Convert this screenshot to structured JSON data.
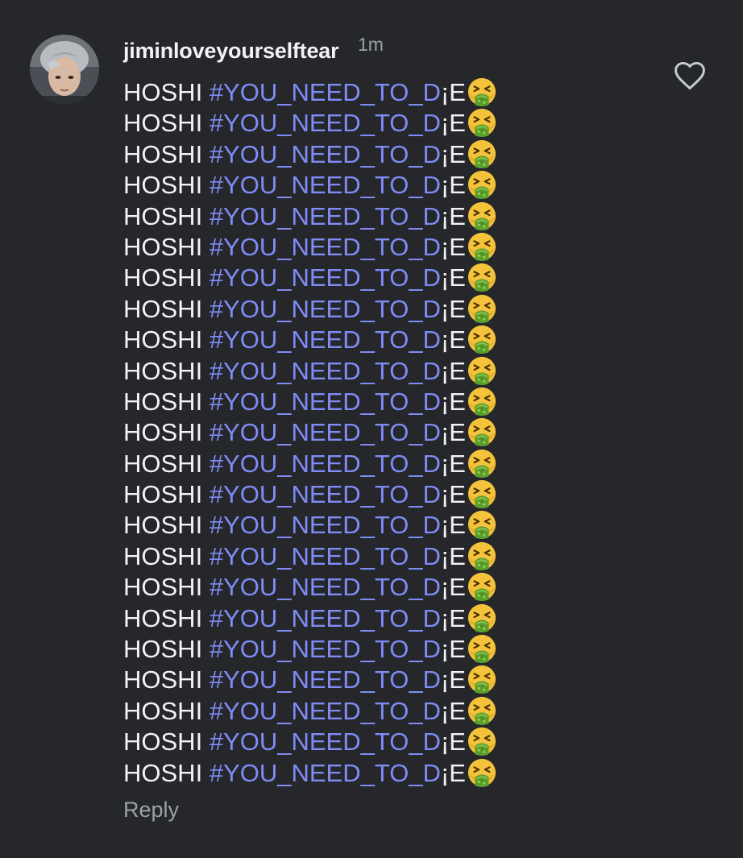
{
  "comment": {
    "username": "jiminloveyourselftear",
    "timestamp": "1m",
    "avatar_icon": "profile-photo",
    "like_icon": "heart-outline-icon",
    "reply_label": "Reply",
    "lines": [
      {
        "word": "HOSHI",
        "hashtag": "#YOU_NEED_TO_D",
        "tail": "¡E",
        "emoji": "nauseated-face-emoji"
      },
      {
        "word": "HOSHI",
        "hashtag": "#YOU_NEED_TO_D",
        "tail": "¡E",
        "emoji": "nauseated-face-emoji"
      },
      {
        "word": "HOSHI",
        "hashtag": "#YOU_NEED_TO_D",
        "tail": "¡E",
        "emoji": "nauseated-face-emoji"
      },
      {
        "word": "HOSHI",
        "hashtag": "#YOU_NEED_TO_D",
        "tail": "¡E",
        "emoji": "nauseated-face-emoji"
      },
      {
        "word": "HOSHI",
        "hashtag": "#YOU_NEED_TO_D",
        "tail": "¡E",
        "emoji": "nauseated-face-emoji"
      },
      {
        "word": "HOSHI",
        "hashtag": "#YOU_NEED_TO_D",
        "tail": "¡E",
        "emoji": "nauseated-face-emoji"
      },
      {
        "word": "HOSHI",
        "hashtag": "#YOU_NEED_TO_D",
        "tail": "¡E",
        "emoji": "nauseated-face-emoji"
      },
      {
        "word": "HOSHI",
        "hashtag": "#YOU_NEED_TO_D",
        "tail": "¡E",
        "emoji": "nauseated-face-emoji"
      },
      {
        "word": "HOSHI",
        "hashtag": "#YOU_NEED_TO_D",
        "tail": "¡E",
        "emoji": "nauseated-face-emoji"
      },
      {
        "word": "HOSHI",
        "hashtag": "#YOU_NEED_TO_D",
        "tail": "¡E",
        "emoji": "nauseated-face-emoji"
      },
      {
        "word": "HOSHI",
        "hashtag": "#YOU_NEED_TO_D",
        "tail": "¡E",
        "emoji": "nauseated-face-emoji"
      },
      {
        "word": "HOSHI",
        "hashtag": "#YOU_NEED_TO_D",
        "tail": "¡E",
        "emoji": "nauseated-face-emoji"
      },
      {
        "word": "HOSHI",
        "hashtag": "#YOU_NEED_TO_D",
        "tail": "¡E",
        "emoji": "nauseated-face-emoji"
      },
      {
        "word": "HOSHI",
        "hashtag": "#YOU_NEED_TO_D",
        "tail": "¡E",
        "emoji": "nauseated-face-emoji"
      },
      {
        "word": "HOSHI",
        "hashtag": "#YOU_NEED_TO_D",
        "tail": "¡E",
        "emoji": "nauseated-face-emoji"
      },
      {
        "word": "HOSHI",
        "hashtag": "#YOU_NEED_TO_D",
        "tail": "¡E",
        "emoji": "nauseated-face-emoji"
      },
      {
        "word": "HOSHI",
        "hashtag": "#YOU_NEED_TO_D",
        "tail": "¡E",
        "emoji": "nauseated-face-emoji"
      },
      {
        "word": "HOSHI",
        "hashtag": "#YOU_NEED_TO_D",
        "tail": "¡E",
        "emoji": "nauseated-face-emoji"
      },
      {
        "word": "HOSHI",
        "hashtag": "#YOU_NEED_TO_D",
        "tail": "¡E",
        "emoji": "nauseated-face-emoji"
      },
      {
        "word": "HOSHI",
        "hashtag": "#YOU_NEED_TO_D",
        "tail": "¡E",
        "emoji": "nauseated-face-emoji"
      },
      {
        "word": "HOSHI",
        "hashtag": "#YOU_NEED_TO_D",
        "tail": "¡E",
        "emoji": "nauseated-face-emoji"
      },
      {
        "word": "HOSHI",
        "hashtag": "#YOU_NEED_TO_D",
        "tail": "¡E",
        "emoji": "nauseated-face-emoji"
      },
      {
        "word": "HOSHI",
        "hashtag": "#YOU_NEED_TO_D",
        "tail": "¡E",
        "emoji": "nauseated-face-emoji"
      }
    ]
  },
  "colors": {
    "background": "#25272b",
    "text": "#f2f3f5",
    "muted": "#9ca0a8",
    "hashtag": "#7f8cf5"
  }
}
